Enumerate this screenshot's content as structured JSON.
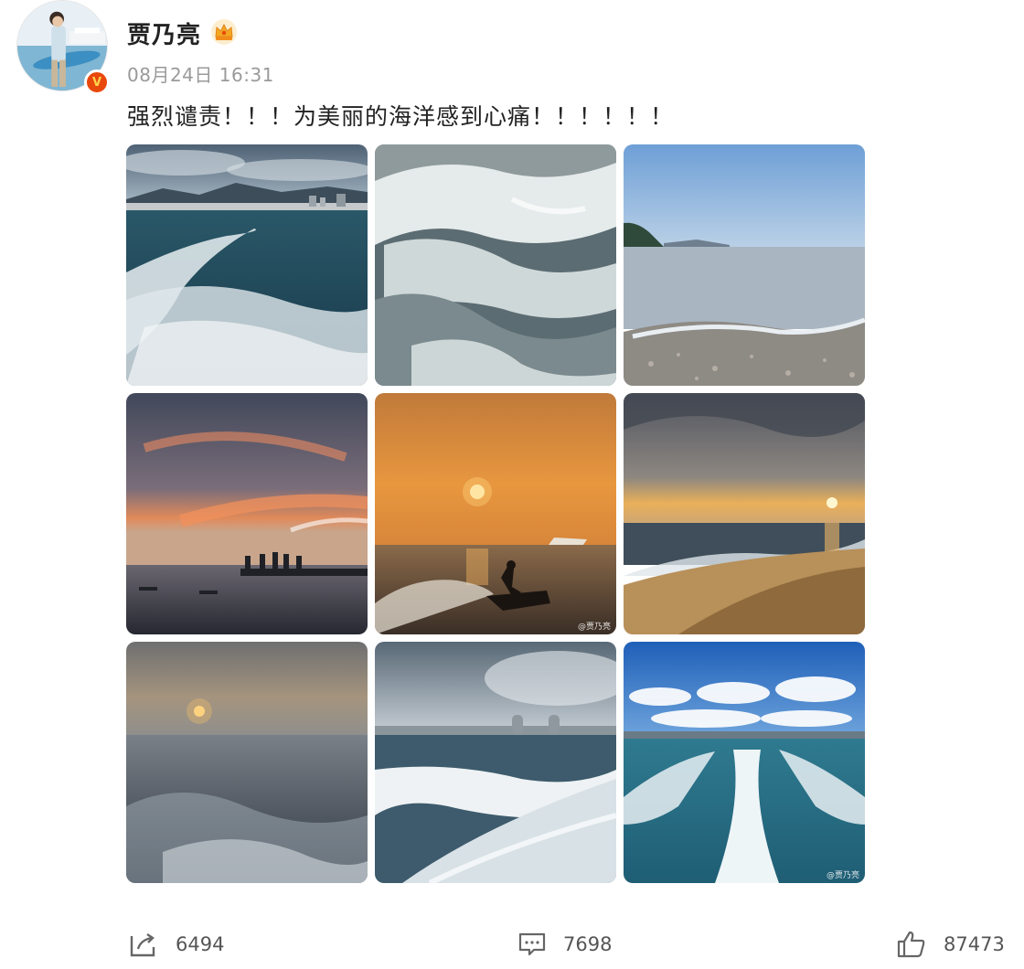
{
  "user": {
    "name": "贾乃亮",
    "avatar_icon": "avatar-photo",
    "verified_badge": "V",
    "member_icon": "crown-icon",
    "badge_color": "#e8480b"
  },
  "post": {
    "timestamp": "08月24日 16:31",
    "text": "强烈谴责！！！为美丽的海洋感到心痛！！！！！！",
    "images": [
      {
        "label": "ocean-wake-city-skyline"
      },
      {
        "label": "close-up-waves"
      },
      {
        "label": "calm-beach-pebbles"
      },
      {
        "label": "sunset-clouds-pier"
      },
      {
        "label": "orange-sunset-jetski",
        "watermark": "@贾乃亮"
      },
      {
        "label": "beach-sunset-shore"
      },
      {
        "label": "hazy-sunset-spray"
      },
      {
        "label": "wave-towers-skyline"
      },
      {
        "label": "boat-wake-blue-sky",
        "watermark": "@贾乃亮"
      }
    ]
  },
  "actions": {
    "share_count": "6494",
    "comment_count": "7698",
    "like_count": "87473"
  }
}
